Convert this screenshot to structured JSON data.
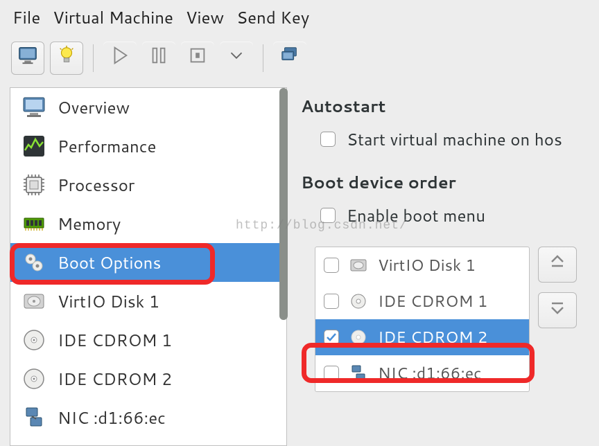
{
  "menu": {
    "file": "File",
    "vm": "Virtual Machine",
    "view": "View",
    "sendkey": "Send Key"
  },
  "sidebar": {
    "items": [
      {
        "label": "Overview"
      },
      {
        "label": "Performance"
      },
      {
        "label": "Processor"
      },
      {
        "label": "Memory"
      },
      {
        "label": "Boot Options"
      },
      {
        "label": "VirtIO Disk 1"
      },
      {
        "label": "IDE CDROM 1"
      },
      {
        "label": "IDE CDROM 2"
      },
      {
        "label": "NIC :d1:66:ec"
      }
    ]
  },
  "detail": {
    "autostart_heading": "Autostart",
    "autostart_label": "Start virtual machine on hos",
    "bootorder_heading": "Boot device order",
    "enable_bootmenu_label": "Enable boot menu",
    "boot_devices": [
      {
        "label": "VirtIO Disk 1"
      },
      {
        "label": "IDE CDROM 1"
      },
      {
        "label": "IDE CDROM 2"
      },
      {
        "label": "NIC :d1:66:ec"
      }
    ]
  },
  "watermark": "http://blog.csdn.net/"
}
